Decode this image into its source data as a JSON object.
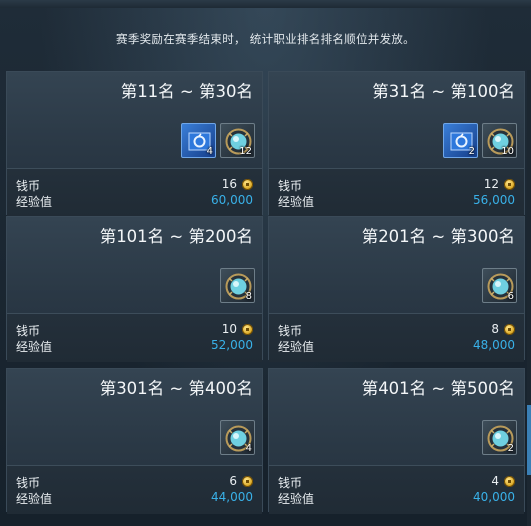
{
  "notice": "赛季奖励在赛季结束时， 统计职业排名排名顺位并发放。",
  "labels": {
    "coin": "钱币",
    "exp": "经验值"
  },
  "cards": [
    {
      "title": "第11名 ~ 第30名",
      "items": [
        {
          "icon": "blue-box-icon",
          "count": "4"
        },
        {
          "icon": "crystal-orb-icon",
          "count": "12"
        }
      ],
      "coin": "16",
      "exp": "60,000"
    },
    {
      "title": "第31名 ~ 第100名",
      "items": [
        {
          "icon": "blue-box-icon",
          "count": "2"
        },
        {
          "icon": "crystal-orb-icon",
          "count": "10"
        }
      ],
      "coin": "12",
      "exp": "56,000"
    },
    {
      "title": "第101名 ~ 第200名",
      "items": [
        {
          "icon": "crystal-orb-icon",
          "count": "8"
        }
      ],
      "coin": "10",
      "exp": "52,000"
    },
    {
      "title": "第201名 ~ 第300名",
      "items": [
        {
          "icon": "crystal-orb-icon",
          "count": "6"
        }
      ],
      "coin": "8",
      "exp": "48,000"
    },
    {
      "title": "第301名 ~ 第400名",
      "items": [
        {
          "icon": "crystal-orb-icon",
          "count": "4"
        }
      ],
      "coin": "6",
      "exp": "44,000"
    },
    {
      "title": "第401名 ~ 第500名",
      "items": [
        {
          "icon": "crystal-orb-icon",
          "count": "2"
        }
      ],
      "coin": "4",
      "exp": "40,000"
    }
  ]
}
